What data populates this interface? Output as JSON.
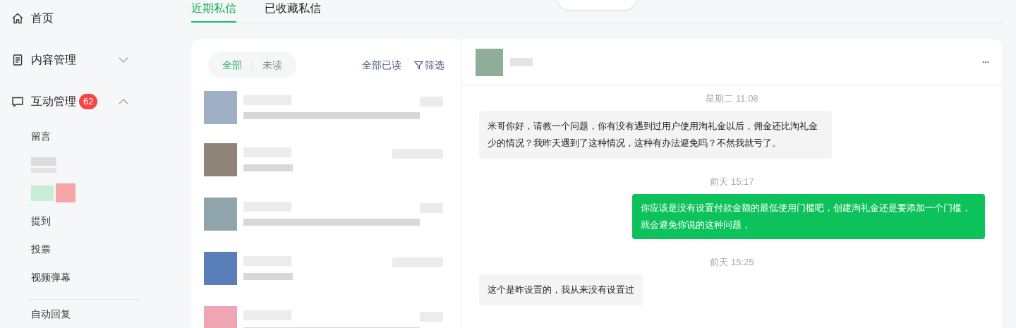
{
  "sidebar": {
    "items": [
      {
        "label": "首页"
      },
      {
        "label": "内容管理",
        "expanded": false
      },
      {
        "label": "互动管理",
        "expanded": true,
        "badge": "62"
      }
    ],
    "sub_items": [
      "留言",
      "提到",
      "投票",
      "视频弹幕"
    ],
    "after_divider": [
      "自动回复"
    ]
  },
  "tabs": [
    {
      "label": "近期私信",
      "selected": true
    },
    {
      "label": "已收藏私信",
      "selected": false
    }
  ],
  "list_panel": {
    "filters": [
      {
        "label": "全部",
        "selected": true
      },
      {
        "label": "未读",
        "selected": false
      }
    ],
    "mark_all_read": "全部已读",
    "filter_button": "筛选"
  },
  "chat": {
    "more": "···",
    "messages": [
      {
        "kind": "time",
        "text": "星期二 11:08"
      },
      {
        "kind": "received",
        "text": "米哥你好，请教一个问题，你有没有遇到过用户使用淘礼金以后，佣金还比淘礼金少的情况？我昨天遇到了这种情况，这种有办法避免吗？不然我就亏了。"
      },
      {
        "kind": "time",
        "text": "前天 15:17"
      },
      {
        "kind": "sent",
        "text": "你应该是没有设置付款金额的最低使用门槛吧，创建淘礼金还是要添加一个门槛，就会避免你说的这种问题，"
      },
      {
        "kind": "time",
        "text": "前天 15:25"
      },
      {
        "kind": "received",
        "text": "这个是昨设置的，我从来没有设置过"
      }
    ]
  }
}
